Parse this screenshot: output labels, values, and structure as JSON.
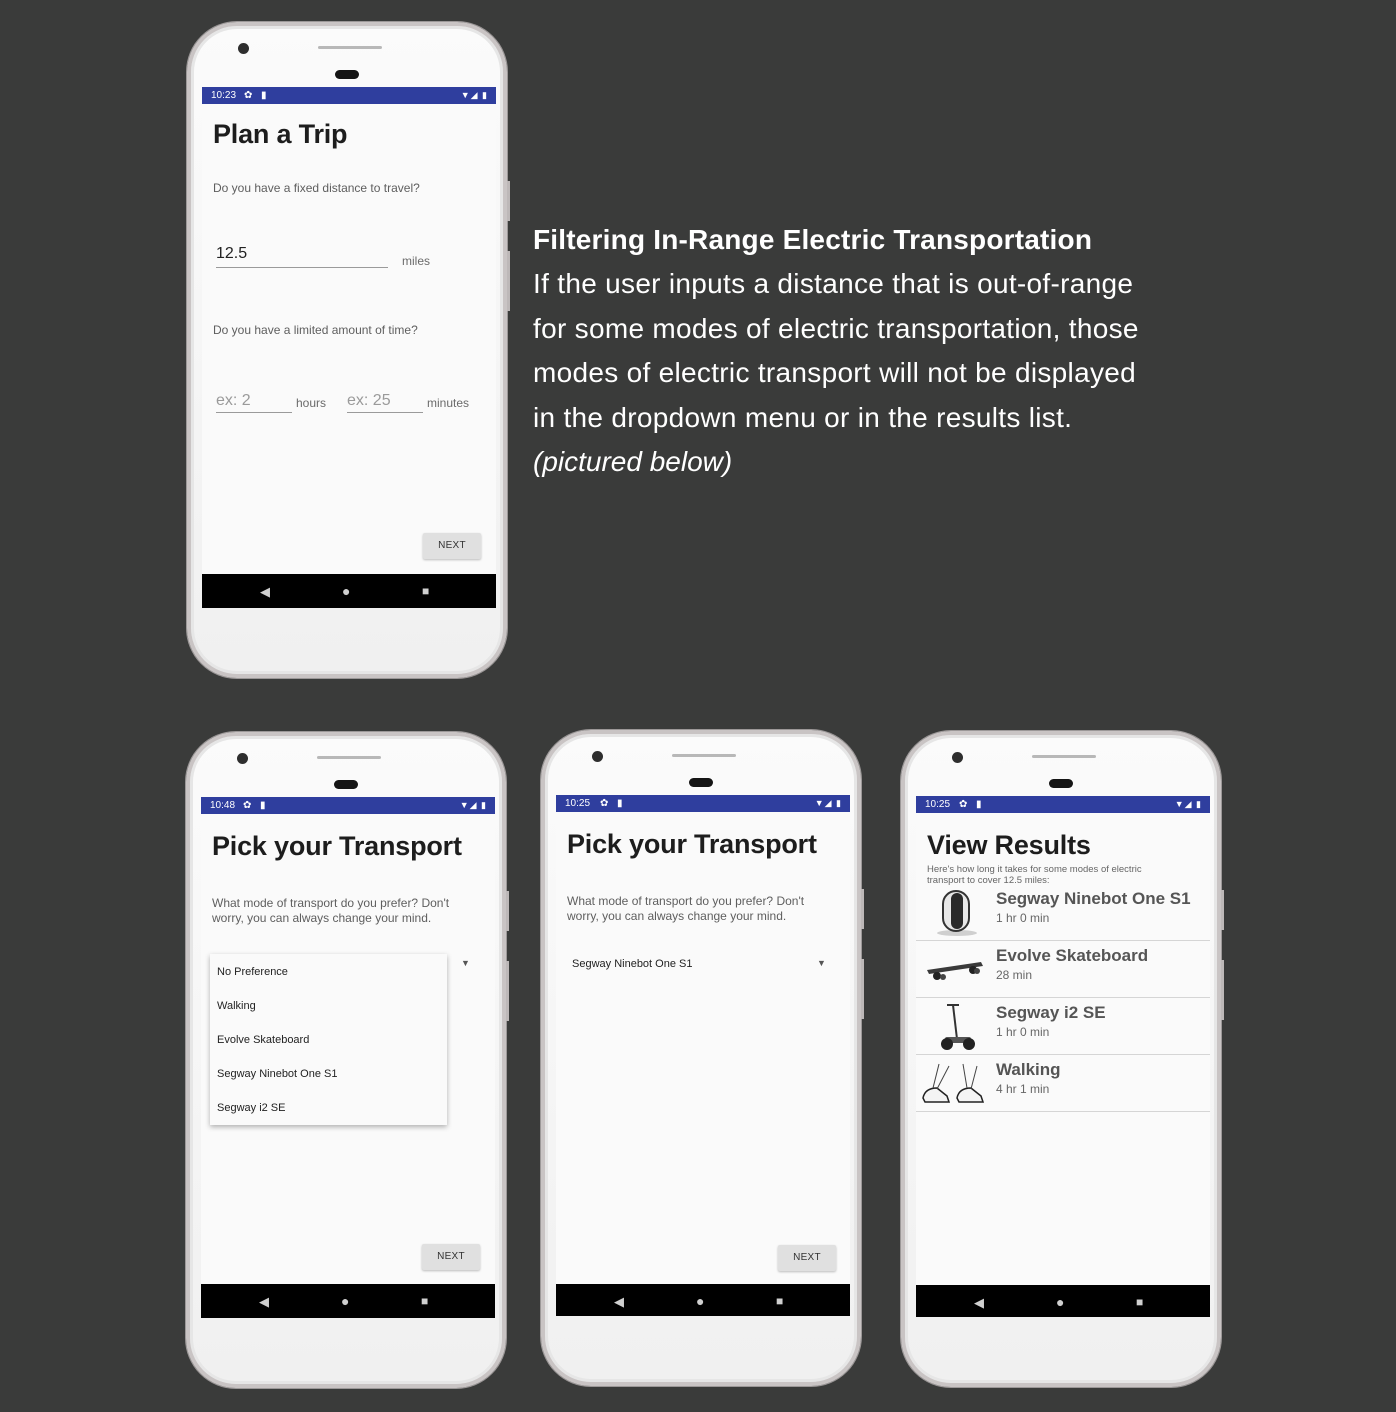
{
  "caption": {
    "heading": "Filtering In-Range Electric Transportation",
    "lines": [
      "If the user inputs a distance that is out-of-range",
      "for some modes of electric transportation, those",
      "modes of electric transport will not be displayed",
      "in the dropdown menu or in the results list."
    ],
    "note": "(pictured below)"
  },
  "icons": {
    "status_settings": "gear-icon",
    "status_sd": "sd-card-icon",
    "wifi_signal_battery": "wifi-signal-battery-icons",
    "nav_back": "back-triangle-icon",
    "nav_home": "home-circle-icon",
    "nav_recents": "recents-square-icon"
  },
  "colors": {
    "status_bar": "#2f3e9e",
    "nav_bar": "#000000",
    "background": "#3a3b3a"
  },
  "phone1": {
    "time": "10:23",
    "title": "Plan a Trip",
    "distance_question": "Do you have a fixed distance to travel?",
    "distance_value": "12.5",
    "distance_unit": "miles",
    "time_question": "Do you have a limited amount of time?",
    "hours_placeholder": "ex: 2",
    "hours_unit": "hours",
    "minutes_placeholder": "ex: 25",
    "minutes_unit": "minutes",
    "next_label": "NEXT"
  },
  "phone2": {
    "time": "10:48",
    "title": "Pick your Transport",
    "prompt_line1": "What mode of transport do you prefer? Don't",
    "prompt_line2": "worry, you can always change your mind.",
    "dropdown_options": [
      "No Preference",
      "Walking",
      "Evolve Skateboard",
      "Segway Ninebot One S1",
      "Segway i2 SE"
    ],
    "next_label": "NEXT"
  },
  "phone3": {
    "time": "10:25",
    "title": "Pick your Transport",
    "prompt_line1": "What mode of transport do you prefer? Don't",
    "prompt_line2": "worry, you can always change your mind.",
    "selected": "Segway Ninebot One S1",
    "next_label": "NEXT"
  },
  "phone4": {
    "time": "10:25",
    "title": "View Results",
    "subtitle_line1": "Here's how long it takes for some modes of electric",
    "subtitle_line2": "transport to cover 12.5 miles:",
    "results": [
      {
        "name": "Segway Ninebot One S1",
        "time": "1 hr 0 min"
      },
      {
        "name": "Evolve Skateboard",
        "time": "28 min"
      },
      {
        "name": "Segway i2 SE",
        "time": "1 hr 0 min"
      },
      {
        "name": "Walking",
        "time": "4 hr 1 min"
      }
    ]
  }
}
